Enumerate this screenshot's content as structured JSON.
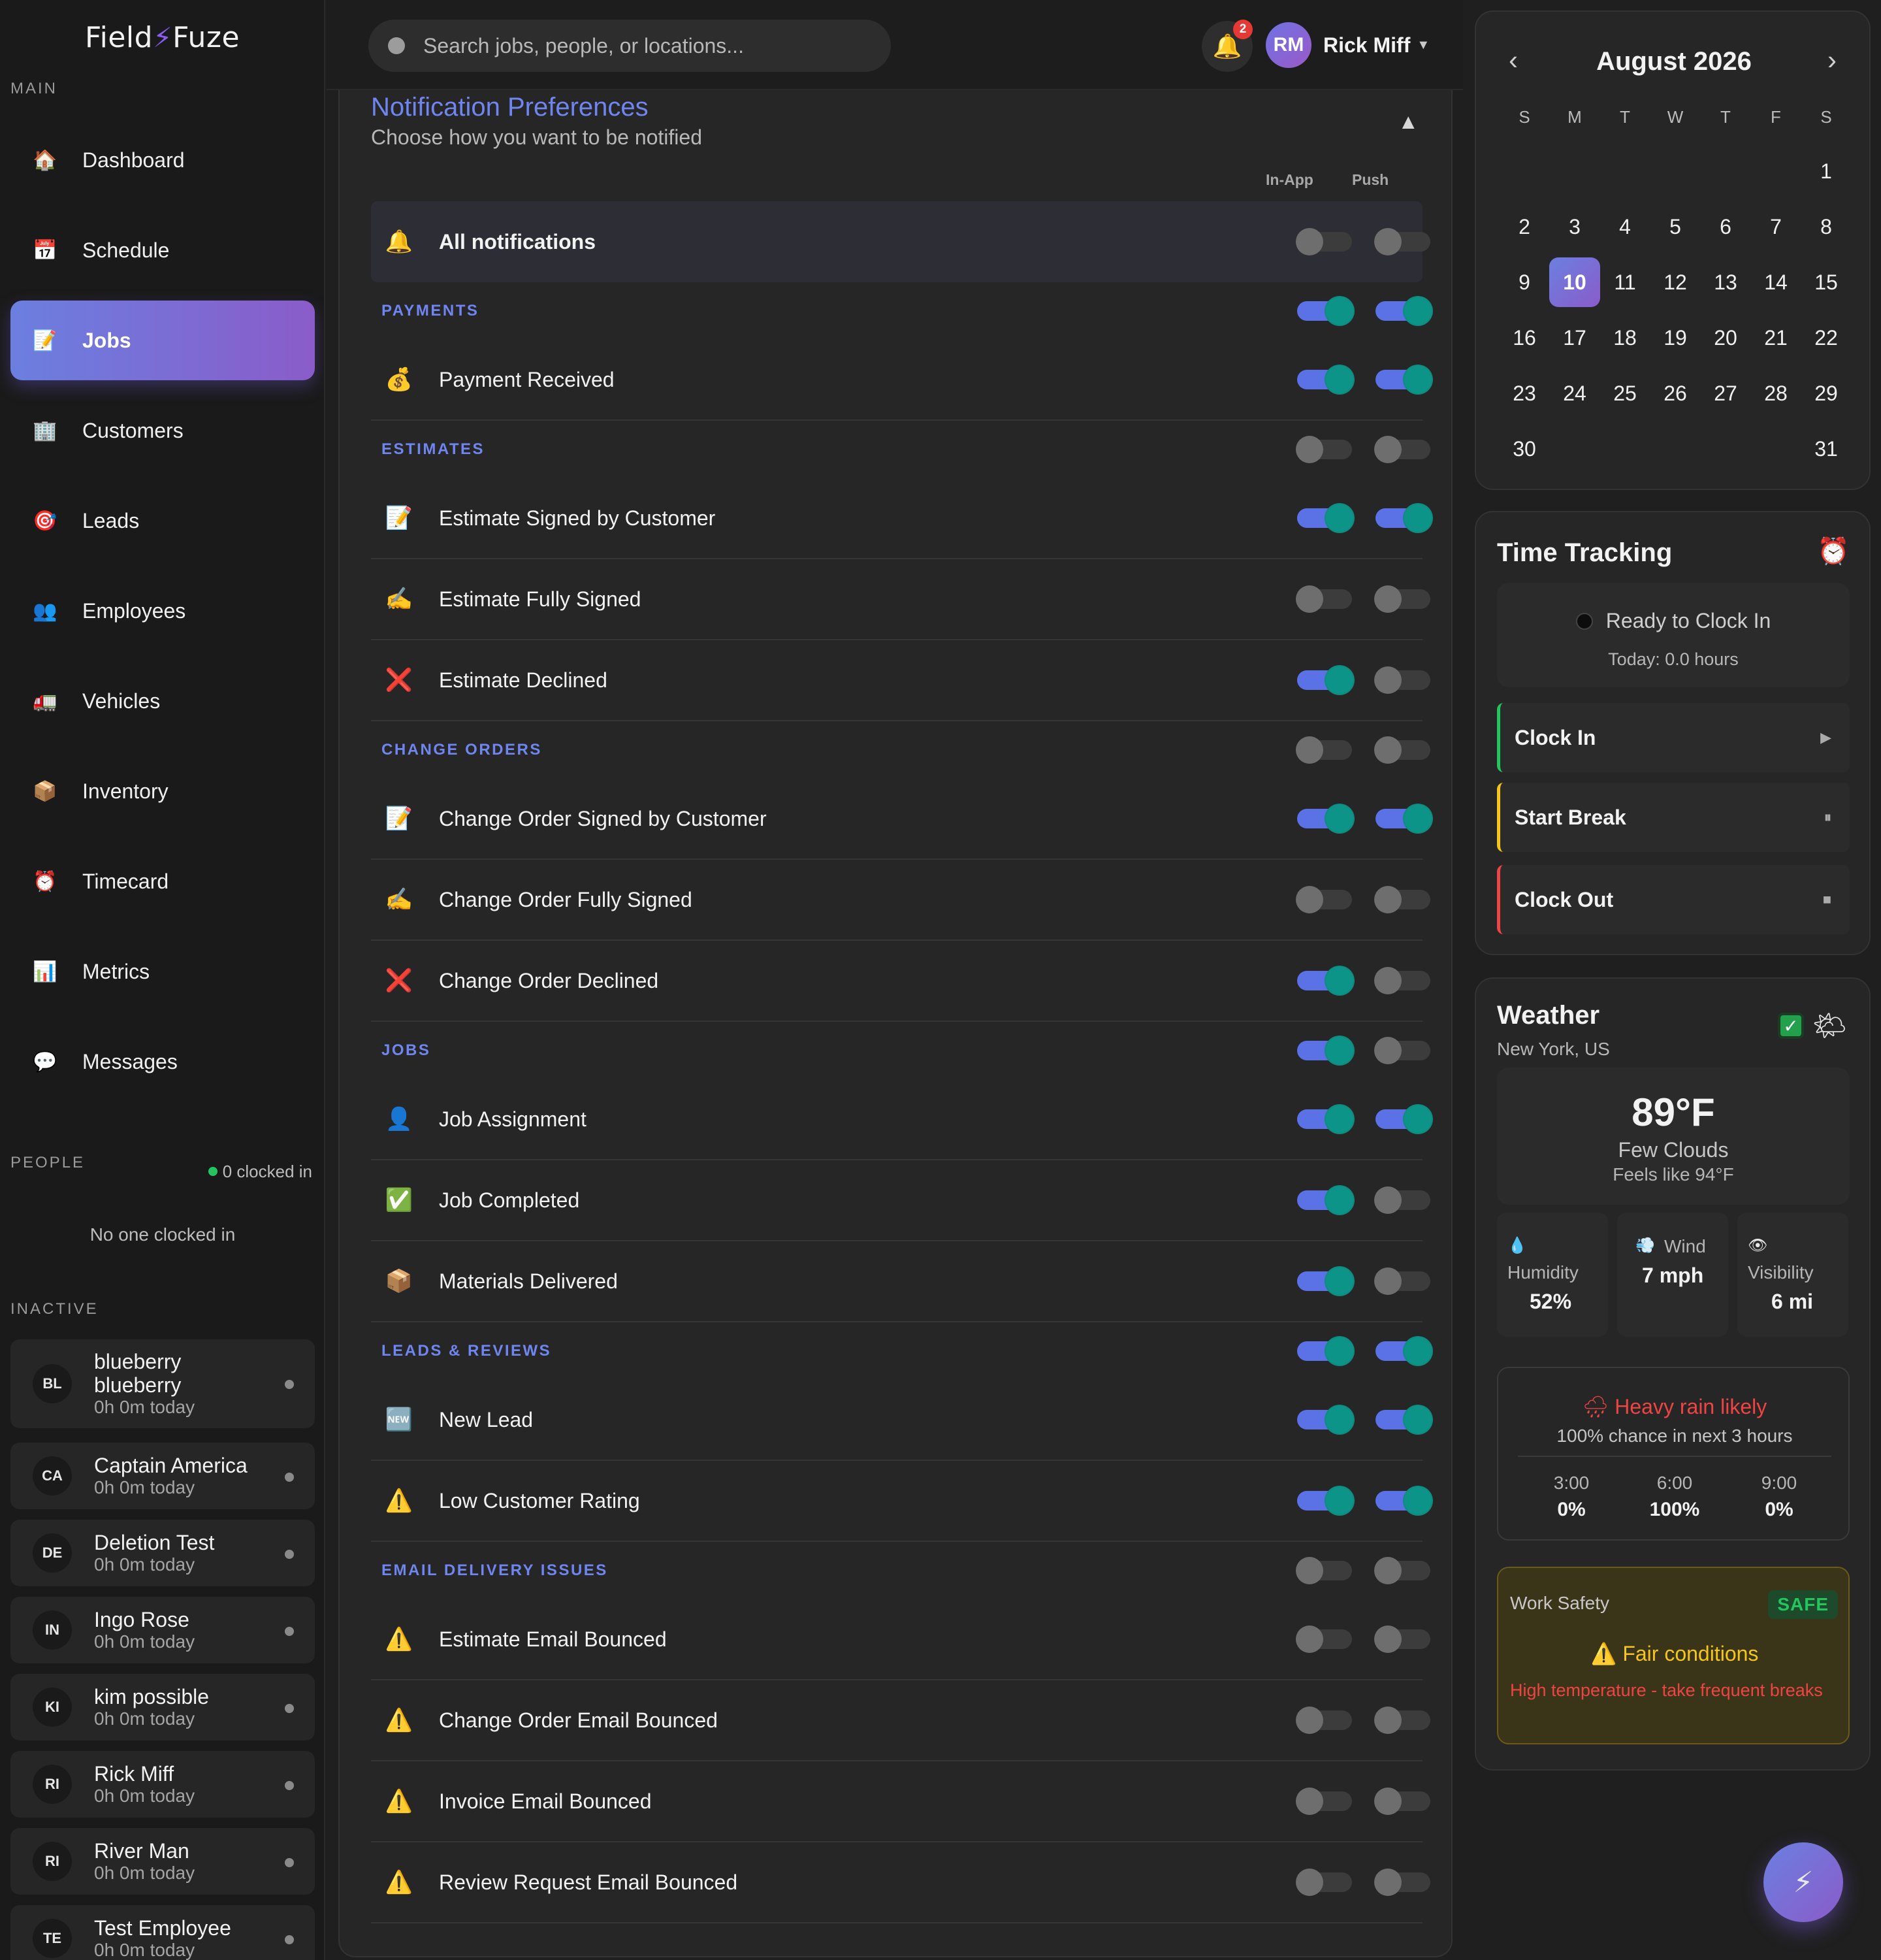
{
  "sidebar": {
    "logo": {
      "left": "Field",
      "right": "Fuze"
    },
    "main_label": "MAIN",
    "nav": [
      {
        "label": "Dashboard",
        "icon": "🏠",
        "name": "house-icon"
      },
      {
        "label": "Schedule",
        "icon": "📅",
        "name": "calendar-icon"
      },
      {
        "label": "Jobs",
        "icon": "📝",
        "name": "memo-icon"
      },
      {
        "label": "Customers",
        "icon": "🏢",
        "name": "building-icon"
      },
      {
        "label": "Leads",
        "icon": "🎯",
        "name": "target-icon"
      },
      {
        "label": "Employees",
        "icon": "👥",
        "name": "people-icon"
      },
      {
        "label": "Vehicles",
        "icon": "🚛",
        "name": "truck-icon"
      },
      {
        "label": "Inventory",
        "icon": "📦",
        "name": "package-icon"
      },
      {
        "label": "Timecard",
        "icon": "⏰",
        "name": "alarm-clock-icon"
      },
      {
        "label": "Metrics",
        "icon": "📊",
        "name": "bar-chart-icon"
      },
      {
        "label": "Messages",
        "icon": "💬",
        "name": "speech-bubble-icon"
      }
    ],
    "active_nav": "Jobs",
    "people_label": "PEOPLE",
    "clocked_in": "0 clocked in",
    "no_one": "No one clocked in",
    "inactive_label": "INACTIVE",
    "people": [
      {
        "initials": "BL",
        "name": "blueberry blueberry",
        "time": "0h 0m today"
      },
      {
        "initials": "CA",
        "name": "Captain America",
        "time": "0h 0m today"
      },
      {
        "initials": "DE",
        "name": "Deletion Test",
        "time": "0h 0m today"
      },
      {
        "initials": "IN",
        "name": "Ingo Rose",
        "time": "0h 0m today"
      },
      {
        "initials": "KI",
        "name": "kim possible",
        "time": "0h 0m today"
      },
      {
        "initials": "RI",
        "name": "Rick Miff",
        "time": "0h 0m today"
      },
      {
        "initials": "RI",
        "name": "River Man",
        "time": "0h 0m today"
      },
      {
        "initials": "TE",
        "name": "Test Employee",
        "time": "0h 0m today"
      }
    ]
  },
  "topbar": {
    "search_placeholder": "Search jobs, people, or locations...",
    "notification_count": "2",
    "user_initials": "RM",
    "user_name": "Rick Miff"
  },
  "prefs": {
    "title": "Notification Preferences",
    "subtitle": "Choose how you want to be notified",
    "col_inapp": "In-App",
    "col_push": "Push",
    "all": {
      "label": "All notifications",
      "icon": "🔔",
      "inapp": false,
      "push": false
    },
    "rows": [
      {
        "type": "category",
        "label": "PAYMENTS",
        "inapp": true,
        "push": true
      },
      {
        "type": "item",
        "label": "Payment Received",
        "icon": "💰",
        "icon_name": "money-bag-icon",
        "inapp": true,
        "push": true
      },
      {
        "type": "category",
        "label": "ESTIMATES",
        "inapp": false,
        "push": false
      },
      {
        "type": "item",
        "label": "Estimate Signed by Customer",
        "icon": "📝",
        "icon_name": "memo-icon",
        "inapp": true,
        "push": true
      },
      {
        "type": "item",
        "label": "Estimate Fully Signed",
        "icon": "✍️",
        "icon_name": "writing-hand-icon",
        "inapp": false,
        "push": false
      },
      {
        "type": "item",
        "label": "Estimate Declined",
        "icon": "❌",
        "icon_name": "cross-mark-icon",
        "inapp": true,
        "push": false
      },
      {
        "type": "category",
        "label": "CHANGE ORDERS",
        "inapp": false,
        "push": false
      },
      {
        "type": "item",
        "label": "Change Order Signed by Customer",
        "icon": "📝",
        "icon_name": "memo-icon",
        "inapp": true,
        "push": true
      },
      {
        "type": "item",
        "label": "Change Order Fully Signed",
        "icon": "✍️",
        "icon_name": "writing-hand-icon",
        "inapp": false,
        "push": false
      },
      {
        "type": "item",
        "label": "Change Order Declined",
        "icon": "❌",
        "icon_name": "cross-mark-icon",
        "inapp": true,
        "push": false
      },
      {
        "type": "category",
        "label": "JOBS",
        "inapp": true,
        "push": false
      },
      {
        "type": "item",
        "label": "Job Assignment",
        "icon": "👤",
        "icon_name": "person-icon",
        "inapp": true,
        "push": true
      },
      {
        "type": "item",
        "label": "Job Completed",
        "icon": "✅",
        "icon_name": "check-mark-icon",
        "inapp": true,
        "push": false
      },
      {
        "type": "item",
        "label": "Materials Delivered",
        "icon": "📦",
        "icon_name": "package-icon",
        "inapp": true,
        "push": false
      },
      {
        "type": "category",
        "label": "LEADS & REVIEWS",
        "inapp": true,
        "push": true
      },
      {
        "type": "item",
        "label": "New Lead",
        "icon": "🆕",
        "icon_name": "new-badge-icon",
        "inapp": true,
        "push": true
      },
      {
        "type": "item",
        "label": "Low Customer Rating",
        "icon": "⚠️",
        "icon_name": "warning-icon",
        "inapp": true,
        "push": true
      },
      {
        "type": "category",
        "label": "EMAIL DELIVERY ISSUES",
        "inapp": false,
        "push": false
      },
      {
        "type": "item",
        "label": "Estimate Email Bounced",
        "icon": "⚠️",
        "icon_name": "warning-icon",
        "inapp": false,
        "push": false
      },
      {
        "type": "item",
        "label": "Change Order Email Bounced",
        "icon": "⚠️",
        "icon_name": "warning-icon",
        "inapp": false,
        "push": false
      },
      {
        "type": "item",
        "label": "Invoice Email Bounced",
        "icon": "⚠️",
        "icon_name": "warning-icon",
        "inapp": false,
        "push": false
      },
      {
        "type": "item",
        "label": "Review Request Email Bounced",
        "icon": "⚠️",
        "icon_name": "warning-icon",
        "inapp": false,
        "push": false
      }
    ]
  },
  "calendar": {
    "month_label": "August 2026",
    "dow": [
      "S",
      "M",
      "T",
      "W",
      "T",
      "F",
      "S"
    ],
    "weeks": [
      [
        "",
        "",
        "",
        "",
        "",
        "",
        "1"
      ],
      [
        "2",
        "3",
        "4",
        "5",
        "6",
        "7",
        "8"
      ],
      [
        "9",
        "10",
        "11",
        "12",
        "13",
        "14",
        "15"
      ],
      [
        "16",
        "17",
        "18",
        "19",
        "20",
        "21",
        "22"
      ],
      [
        "23",
        "24",
        "25",
        "26",
        "27",
        "28",
        "29"
      ],
      [
        "30",
        "",
        "",
        "",
        "",
        "",
        "31"
      ]
    ],
    "today": "10"
  },
  "time_tracking": {
    "title": "Time Tracking",
    "status": "Ready to Clock In",
    "today": "Today: 0.0 hours",
    "buttons": [
      {
        "label": "Clock In",
        "symbol": "▶",
        "color": "#22c55e"
      },
      {
        "label": "Start Break",
        "symbol": "⏸",
        "color": "#f5c518"
      },
      {
        "label": "Clock Out",
        "symbol": "■",
        "color": "#ef4444"
      }
    ]
  },
  "weather": {
    "title": "Weather",
    "location": "New York, US",
    "temp": "89°F",
    "desc": "Few Clouds",
    "feels": "Feels like 94°F",
    "humidity_label": "Humidity",
    "humidity": "52%",
    "wind_label": "Wind",
    "wind": "7 mph",
    "visibility_label": "Visibility",
    "visibility": "6 mi",
    "rain_title": "Heavy rain likely",
    "rain_sub": "100% chance in next 3 hours",
    "forecast": [
      {
        "time": "3:00",
        "pct": "0%"
      },
      {
        "time": "6:00",
        "pct": "100%"
      },
      {
        "time": "9:00",
        "pct": "0%"
      }
    ],
    "safety_label": "Work Safety",
    "safety_badge": "SAFE",
    "safety_condition": "Fair conditions",
    "safety_warning": "High temperature - take frequent breaks"
  }
}
